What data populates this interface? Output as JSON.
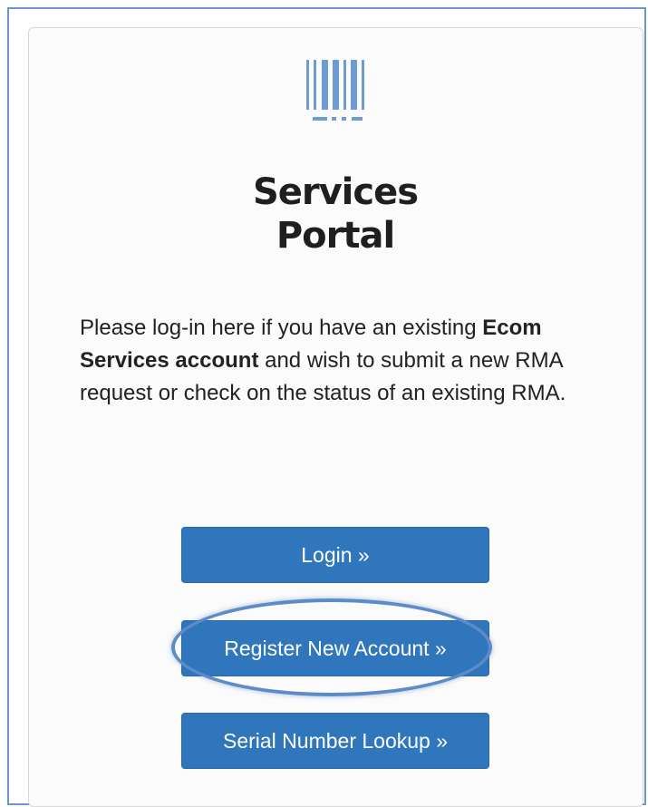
{
  "card": {
    "title_line1": "Services",
    "title_line2": "Portal",
    "description": {
      "part1": "Please log-in here if you have an existing ",
      "bold1": "Ecom Services account",
      "part2": " and wish to submit a new RMA request or check on the status of an existing RMA."
    }
  },
  "buttons": {
    "login": "Login »",
    "register": "Register New Account »",
    "serial": "Serial Number Lookup »"
  },
  "colors": {
    "button": "#2f76bd",
    "logo": "#6e9bd1",
    "highlight": "#5b8cc7"
  },
  "icons": {
    "logo": "barcode-icon"
  }
}
